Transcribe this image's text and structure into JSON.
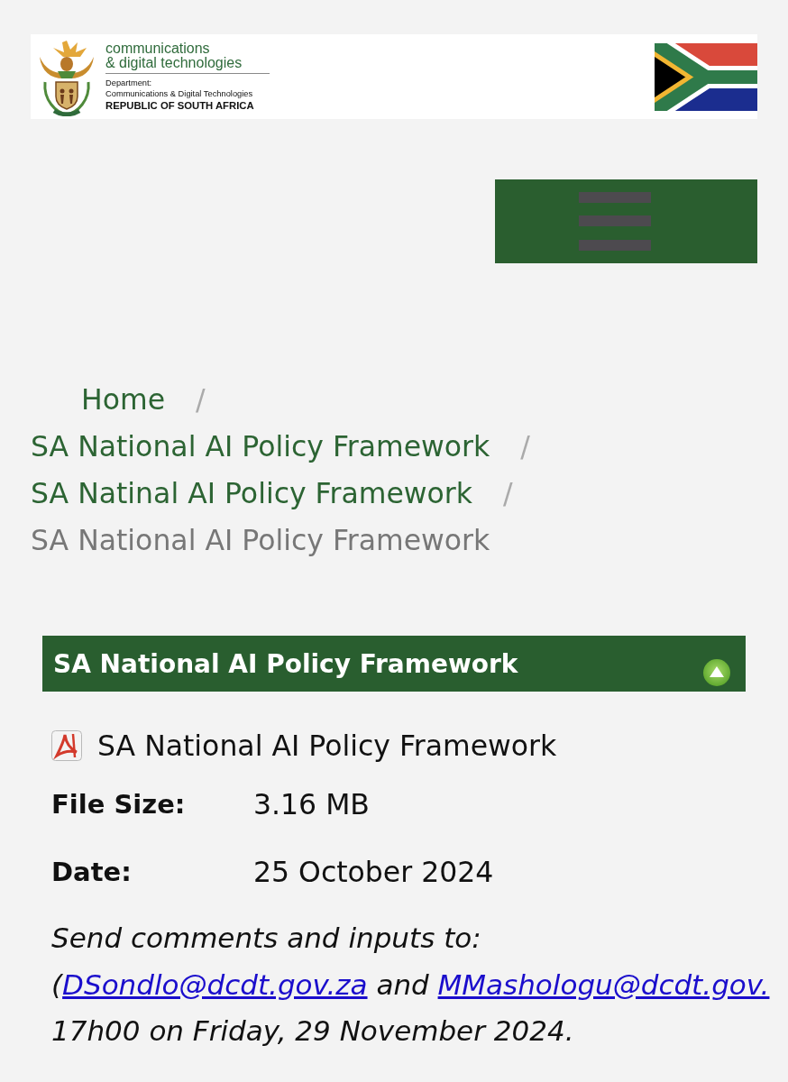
{
  "header": {
    "logo": {
      "line_1": "communications",
      "line_2": "& digital technologies",
      "department_label": "Department:",
      "department_name": "Communications & Digital Technologies",
      "country": "REPUBLIC OF SOUTH AFRICA"
    }
  },
  "breadcrumb": [
    {
      "label": "Home",
      "current": false,
      "separator": "/"
    },
    {
      "label": "SA National AI Policy Framework",
      "current": false,
      "separator": "/"
    },
    {
      "label": "SA Natinal AI Policy Framework",
      "current": false,
      "separator": "/"
    },
    {
      "label": "SA National AI Policy Framework",
      "current": true
    }
  ],
  "section": {
    "title": "SA National AI Policy Framework",
    "expanded": true
  },
  "file": {
    "name": "SA National AI Policy Framework",
    "details": [
      {
        "label": "File Size:",
        "value": "3.16 MB"
      },
      {
        "label": "Date:",
        "value": "25 October 2024"
      }
    ]
  },
  "comment": {
    "lines": [
      [
        {
          "kind": "text",
          "text": "Send comments and inputs to:"
        }
      ],
      [
        {
          "kind": "text",
          "text": "("
        },
        {
          "kind": "link",
          "text": "DSondlo@dcdt.gov.za"
        },
        {
          "kind": "text",
          "text": " and "
        },
        {
          "kind": "link",
          "text": "MMashologu@dcdt.gov."
        }
      ],
      [
        {
          "kind": "text",
          "text": "17h00 on Friday, 29 November 2024."
        }
      ]
    ]
  }
}
